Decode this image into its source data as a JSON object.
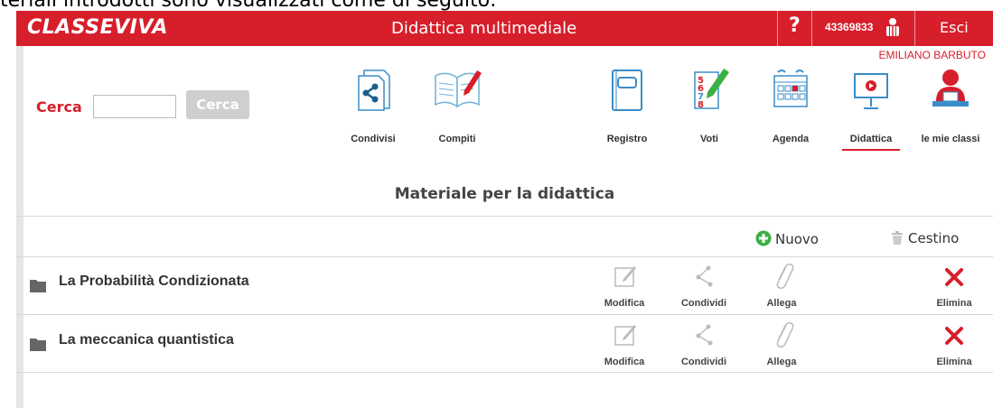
{
  "caption": "teriali introdotti sono visualizzati come di seguito:",
  "header": {
    "logo": "CLASSEVIVA",
    "title": "Didattica multimediale",
    "help_label": "?",
    "user_code": "43369833",
    "logout_label": "Esci",
    "username": "EMILIANO BARBUTO",
    "brand_color": "#d71e2b"
  },
  "search": {
    "label": "Cerca",
    "value": "",
    "button_label": "Cerca"
  },
  "nav": {
    "items": [
      {
        "label": "Condivisi",
        "icon": "share-icon"
      },
      {
        "label": "Compiti",
        "icon": "book-pen-icon"
      },
      {
        "label": "Registro",
        "icon": "register-icon"
      },
      {
        "label": "Voti",
        "icon": "grades-icon"
      },
      {
        "label": "Agenda",
        "icon": "calendar-icon"
      },
      {
        "label": "Didattica",
        "icon": "projector-icon",
        "active": true
      },
      {
        "label": "le mie classi",
        "icon": "teacher-icon"
      }
    ]
  },
  "main": {
    "title": "Materiale per la didattica",
    "new_label": "Nuovo",
    "trash_label": "Cestino",
    "folders": [
      {
        "name": "La Probabilità Condizionata"
      },
      {
        "name": "La meccanica quantistica"
      }
    ],
    "actions": {
      "edit": "Modifica",
      "share": "Condividi",
      "attach": "Allega",
      "delete": "Elimina"
    }
  }
}
